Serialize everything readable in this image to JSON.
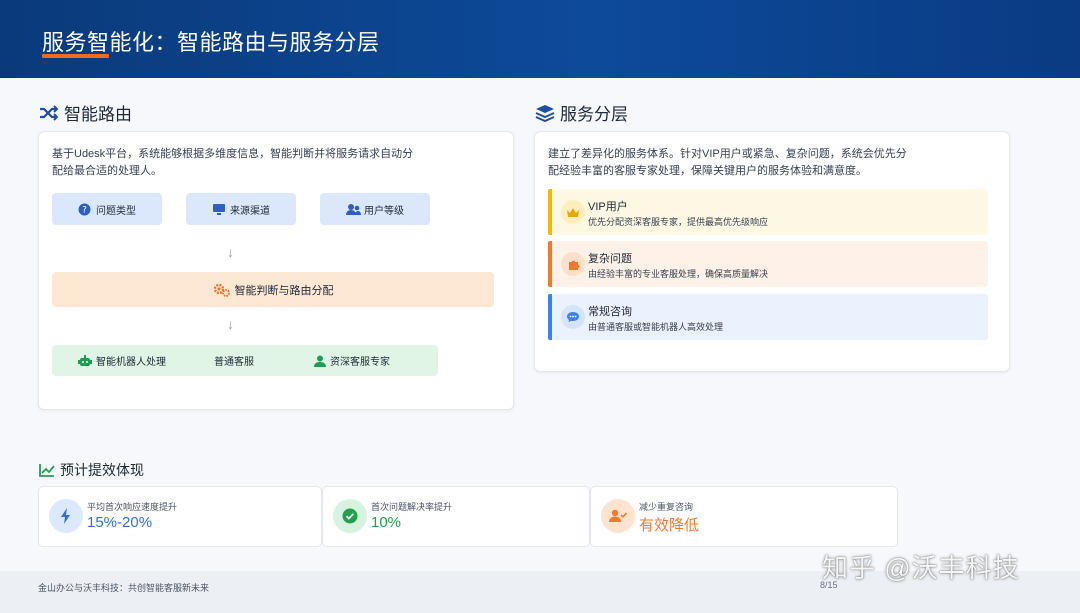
{
  "header": {
    "title": "服务智能化：智能路由与服务分层"
  },
  "routing": {
    "title": "智能路由",
    "description_line1": "基于Udesk平台，系统能够根据多维度信息，智能判断并将服务请求自动分",
    "description_line2": "配给最合适的处理人。",
    "inputs": [
      {
        "label": "问题类型",
        "icon": "question-circle-icon"
      },
      {
        "label": "来源渠道",
        "icon": "monitor-icon"
      },
      {
        "label": "用户等级",
        "icon": "user-group-icon"
      }
    ],
    "router_label": "智能判断与路由分配",
    "router_icon": "gears-icon",
    "outputs": [
      {
        "label": "智能机器人处理",
        "icon": "robot-icon"
      },
      {
        "label": "普通客服",
        "icon": ""
      },
      {
        "label": "资深客服专家",
        "icon": "user-tie-icon"
      }
    ]
  },
  "layers": {
    "title": "服务分层",
    "description_line1": "建立了差异化的服务体系。针对VIP用户或紧急、复杂问题，系统会优先分",
    "description_line2": "配经验丰富的客服专家处理，保障关键用户的服务体验和满意度。",
    "items": [
      {
        "title": "VIP用户",
        "desc": "优先分配资深客服专家，提供最高优先级响应",
        "icon": "crown-icon",
        "accent": "#f5b800",
        "bg": "#fdf8e3"
      },
      {
        "title": "复杂问题",
        "desc": "由经验丰富的专业客服处理，确保高质量解决",
        "icon": "puzzle-icon",
        "accent": "#f07a2a",
        "bg": "#fdf1e8"
      },
      {
        "title": "常规咨询",
        "desc": "由普通客服或智能机器人高效处理",
        "icon": "chat-icon",
        "accent": "#3b82f6",
        "bg": "#eaf2fd"
      }
    ]
  },
  "effects": {
    "title": "预计提效体现",
    "kpis": [
      {
        "label": "平均首次响应速度提升",
        "value": "15%-20%",
        "icon": "bolt-icon",
        "color": "#2f6fd6"
      },
      {
        "label": "首次问题解决率提升",
        "value": "10%",
        "icon": "check-circle-icon",
        "color": "#22a04b"
      },
      {
        "label": "减少重复咨询",
        "value": "有效降低",
        "icon": "user-check-icon",
        "color": "#f07a2a"
      }
    ]
  },
  "footer": {
    "text": "金山办公与沃丰科技：共创智能客服新未来",
    "page": "8/15"
  },
  "watermark": "知乎 @沃丰科技"
}
